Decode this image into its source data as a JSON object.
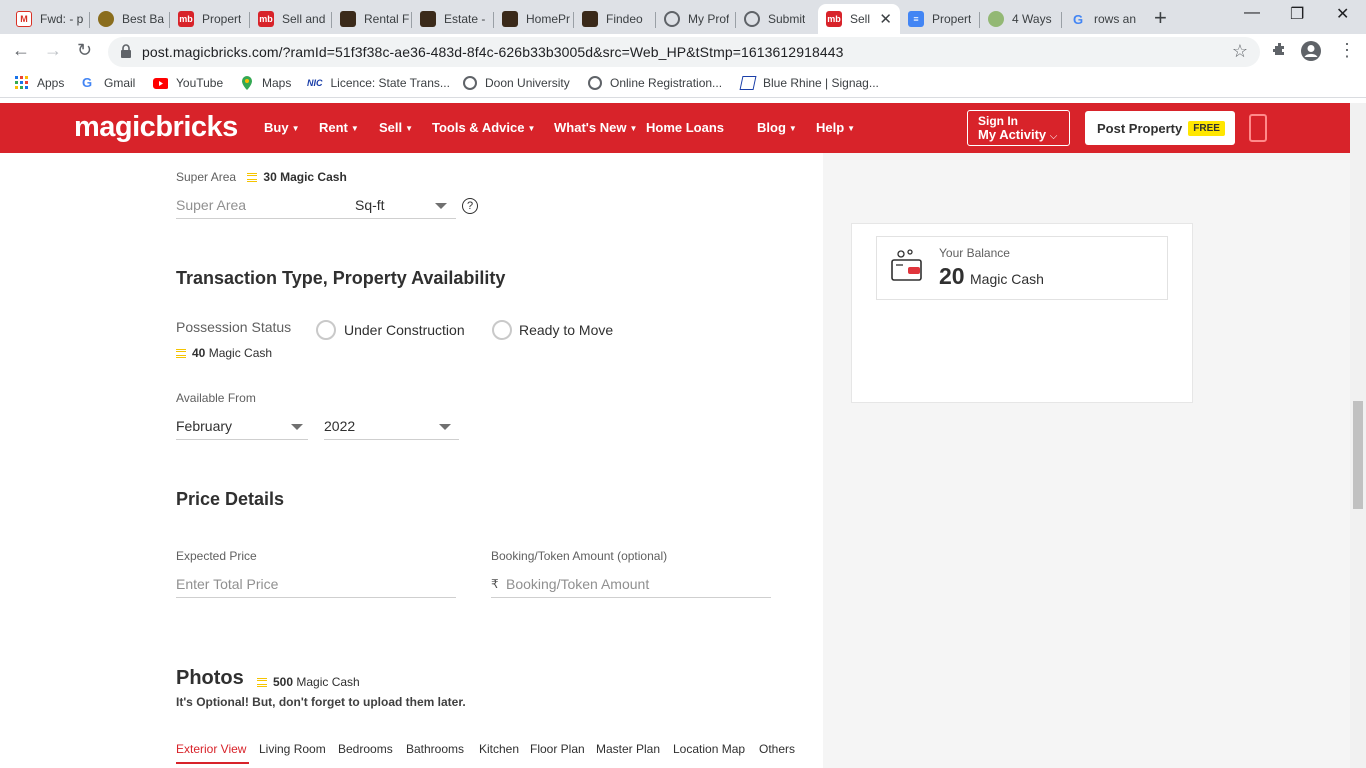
{
  "browser": {
    "tabs": [
      {
        "label": "Fwd: - p",
        "icon": "gmail-icon"
      },
      {
        "label": "Best Ba",
        "icon": "site-icon"
      },
      {
        "label": "Propert",
        "icon": "magicbricks-icon"
      },
      {
        "label": "Sell and",
        "icon": "magicbricks-icon"
      },
      {
        "label": "Rental F",
        "icon": "site-icon"
      },
      {
        "label": "Estate -",
        "icon": "site-icon"
      },
      {
        "label": "HomePr",
        "icon": "site-icon"
      },
      {
        "label": "Findeo",
        "icon": "site-icon"
      },
      {
        "label": "My Prof",
        "icon": "globe-icon"
      },
      {
        "label": "Submit",
        "icon": "globe-icon"
      },
      {
        "label": "Sell",
        "icon": "magicbricks-icon"
      },
      {
        "label": "Propert",
        "icon": "docs-icon"
      },
      {
        "label": "4 Ways",
        "icon": "wikihow-icon"
      },
      {
        "label": "rows an",
        "icon": "google-icon"
      }
    ],
    "url": "post.magicbricks.com/?ramId=51f3f38c-ae36-483d-8f4c-626b33b3005d&src=Web_HP&tStmp=1613612918443",
    "bookmarks": [
      {
        "label": "Apps",
        "icon": "apps-grid-icon"
      },
      {
        "label": "Gmail",
        "icon": "google-icon"
      },
      {
        "label": "YouTube",
        "icon": "youtube-icon"
      },
      {
        "label": "Maps",
        "icon": "maps-pin-icon"
      },
      {
        "label": "Licence: State Trans...",
        "icon": "nic-icon",
        "badge": "NIC"
      },
      {
        "label": "Doon University",
        "icon": "globe-icon"
      },
      {
        "label": "Online Registration...",
        "icon": "globe-icon"
      },
      {
        "label": "Blue Rhine | Signag...",
        "icon": "site-icon"
      }
    ]
  },
  "header": {
    "logo": "magicbricks",
    "menu": [
      "Buy",
      "Rent",
      "Sell",
      "Tools & Advice",
      "What's New",
      "Home Loans",
      "Blog",
      "Help"
    ],
    "signin_line1": "Sign In",
    "signin_line2": "My Activity",
    "post_property": "Post Property",
    "free_badge": "FREE"
  },
  "form": {
    "super_area": {
      "label": "Super Area",
      "magic_cash": "30",
      "magic_cash_unit": "Magic Cash",
      "placeholder": "Super Area",
      "unit": "Sq-ft",
      "help": "?"
    },
    "transaction_heading": "Transaction Type, Property Availability",
    "possession": {
      "label": "Possession Status",
      "magic_cash": "40",
      "magic_cash_unit": "Magic Cash",
      "options": [
        "Under Construction",
        "Ready to Move"
      ]
    },
    "available_from": {
      "label": "Available From",
      "month": "February",
      "year": "2022"
    },
    "price_heading": "Price Details",
    "expected_price": {
      "label": "Expected Price",
      "placeholder": "Enter Total Price"
    },
    "booking": {
      "label": "Booking/Token Amount (optional)",
      "currency": "₹",
      "placeholder": "Booking/Token Amount"
    },
    "photos": {
      "heading": "Photos",
      "magic_cash": "500",
      "magic_cash_unit": "Magic Cash",
      "note": "It's Optional! But, don't forget to upload them later.",
      "tabs": [
        "Exterior View",
        "Living Room",
        "Bedrooms",
        "Bathrooms",
        "Kitchen",
        "Floor Plan",
        "Master Plan",
        "Location Map",
        "Others"
      ],
      "active_tab": "Exterior View"
    }
  },
  "balance": {
    "label": "Your Balance",
    "value": "20",
    "unit": "Magic Cash"
  }
}
